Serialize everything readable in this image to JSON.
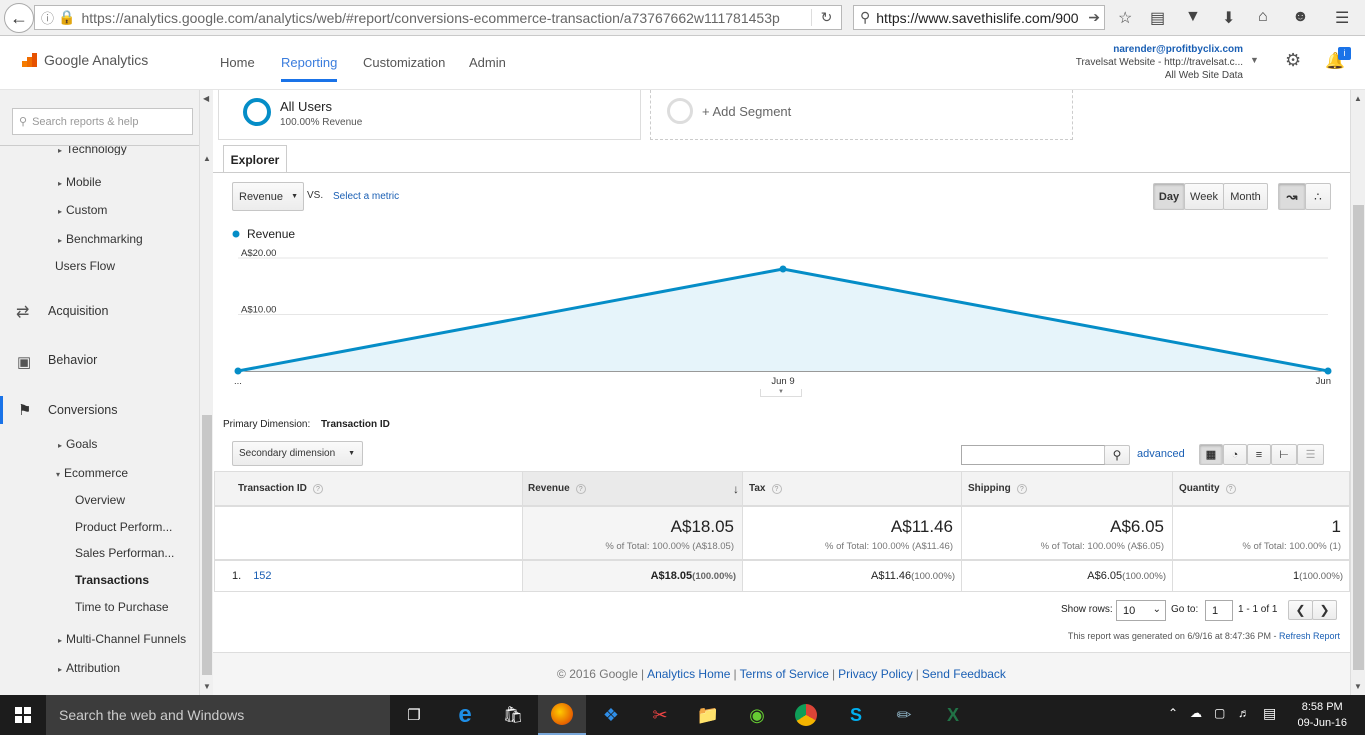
{
  "browser": {
    "url": "https://analytics.google.com/analytics/web/#report/conversions-ecommerce-transaction/a73767662w111781453p",
    "search_value": "https://www.savethislife.com/900"
  },
  "header": {
    "logo_text": "Google Analytics",
    "nav": [
      "Home",
      "Reporting",
      "Customization",
      "Admin"
    ],
    "account_email": "narender@profitbyclix.com",
    "account_property": "Travelsat Website - http://travelsat.c...",
    "account_view": "All Web Site Data"
  },
  "sidebar": {
    "search_placeholder": "Search reports & help",
    "technology": "Technology",
    "mobile": "Mobile",
    "custom": "Custom",
    "benchmarking": "Benchmarking",
    "users_flow": "Users Flow",
    "acquisition": "Acquisition",
    "behavior": "Behavior",
    "conversions": "Conversions",
    "goals": "Goals",
    "ecommerce": "Ecommerce",
    "overview": "Overview",
    "product_performance": "Product Perform...",
    "sales_performance": "Sales Performan...",
    "transactions": "Transactions",
    "time_to_purchase": "Time to Purchase",
    "multichannel": "Multi-Channel Funnels",
    "attribution": "Attribution"
  },
  "segments": {
    "all_users_title": "All Users",
    "all_users_sub": "100.00% Revenue",
    "add_segment": "+ Add Segment"
  },
  "explorer": {
    "tab": "Explorer",
    "metric": "Revenue",
    "vs": "VS.",
    "select_metric": "Select a metric",
    "day": "Day",
    "week": "Week",
    "month": "Month"
  },
  "chart_data": {
    "type": "area",
    "series": [
      {
        "name": "Revenue",
        "values": [
          0,
          18.05,
          0
        ]
      }
    ],
    "x": [
      "...",
      "Jun 9",
      "Jun"
    ],
    "yticks": [
      "A$20.00",
      "A$10.00"
    ],
    "ylim": [
      0,
      20
    ],
    "grid": true,
    "legend": "top-left",
    "color": "#058dc7"
  },
  "table": {
    "primary_dimension_label": "Primary Dimension:",
    "primary_dimension_value": "Transaction ID",
    "secondary_dimension": "Secondary dimension",
    "advanced": "advanced",
    "headers": [
      "Transaction ID",
      "Revenue",
      "Tax",
      "Shipping",
      "Quantity"
    ],
    "totals": [
      {
        "value": "A$18.05",
        "pct": "% of Total: 100.00% (A$18.05)"
      },
      {
        "value": "A$11.46",
        "pct": "% of Total: 100.00% (A$11.46)"
      },
      {
        "value": "A$6.05",
        "pct": "% of Total: 100.00% (A$6.05)"
      },
      {
        "value": "1",
        "pct": "% of Total: 100.00% (1)"
      }
    ],
    "rows": [
      {
        "index": "1.",
        "id": "152",
        "revenue": "A$18.05",
        "revenue_pct": "(100.00%)",
        "tax": "A$11.46",
        "tax_pct": "(100.00%)",
        "shipping": "A$6.05",
        "shipping_pct": "(100.00%)",
        "quantity": "1",
        "quantity_pct": "(100.00%)"
      }
    ],
    "show_rows_label": "Show rows:",
    "show_rows_value": "10",
    "goto_label": "Go to:",
    "goto_value": "1",
    "range": "1 - 1 of 1",
    "generated": "This report was generated on 6/9/16 at 8:47:36 PM -",
    "refresh": "Refresh Report"
  },
  "footer": {
    "copyright": "© 2016 Google",
    "links": [
      "Analytics Home",
      "Terms of Service",
      "Privacy Policy",
      "Send Feedback"
    ]
  },
  "taskbar": {
    "search": "Search the web and Windows",
    "time": "8:58 PM",
    "date": "09-Jun-16"
  }
}
